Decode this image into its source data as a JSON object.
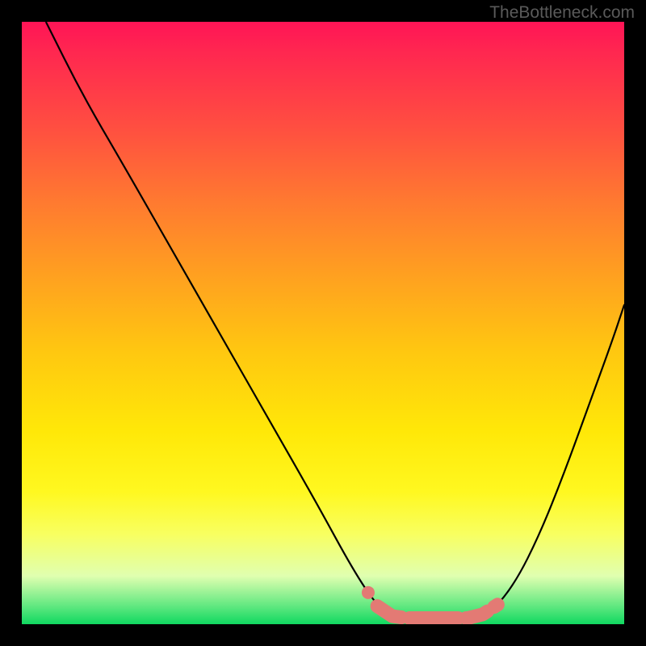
{
  "attribution": "TheBottleneck.com",
  "chart_data": {
    "type": "line",
    "title": "",
    "xlabel": "",
    "ylabel": "",
    "xlim": [
      0,
      100
    ],
    "ylim": [
      0,
      100
    ],
    "series": [
      {
        "name": "bottleneck-curve",
        "x": [
          4,
          10,
          17,
          25,
          33,
          41,
          49,
          55,
          59,
          62,
          65,
          70,
          74,
          78,
          82,
          86,
          90,
          94,
          98,
          100
        ],
        "y": [
          100,
          88,
          76,
          62,
          48,
          34,
          20,
          9,
          3,
          1,
          1,
          1,
          1,
          2,
          7,
          15,
          25,
          36,
          47,
          53
        ]
      }
    ],
    "annotations": [
      {
        "name": "highlight-segment",
        "x_range": [
          59,
          79
        ],
        "color": "#e37a74",
        "style": "thick-dashed"
      }
    ],
    "background": "vertical-gradient-red-to-green"
  }
}
